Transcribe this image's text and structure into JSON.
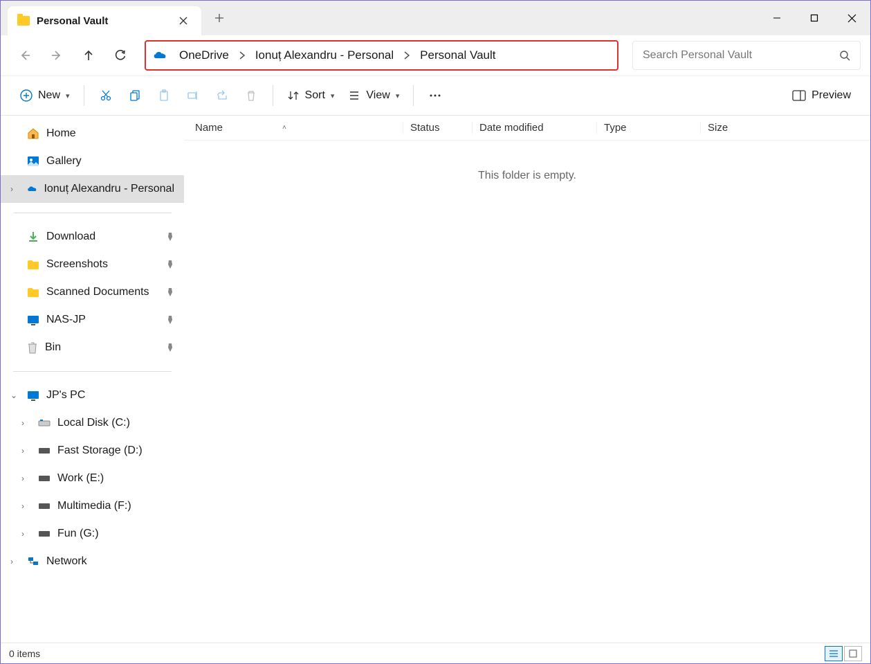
{
  "tab": {
    "title": "Personal Vault"
  },
  "breadcrumb": [
    "OneDrive",
    "Ionuț Alexandru - Personal",
    "Personal Vault"
  ],
  "search": {
    "placeholder": "Search Personal Vault"
  },
  "toolbar": {
    "new": "New",
    "sort": "Sort",
    "view": "View",
    "preview": "Preview"
  },
  "sidebar": {
    "top": [
      {
        "label": "Home",
        "icon": "home"
      },
      {
        "label": "Gallery",
        "icon": "gallery"
      },
      {
        "label": "Ionuț Alexandru - Personal",
        "icon": "cloud",
        "selected": true,
        "expandable": true
      }
    ],
    "quick": [
      {
        "label": "Download",
        "icon": "download"
      },
      {
        "label": "Screenshots",
        "icon": "folder"
      },
      {
        "label": "Scanned Documents",
        "icon": "folder"
      },
      {
        "label": "NAS-JP",
        "icon": "monitor"
      },
      {
        "label": "Bin",
        "icon": "bin"
      }
    ],
    "pc": {
      "label": "JP's PC",
      "expanded": true
    },
    "drives": [
      {
        "label": "Local Disk (C:)"
      },
      {
        "label": "Fast Storage (D:)"
      },
      {
        "label": "Work (E:)"
      },
      {
        "label": "Multimedia (F:)"
      },
      {
        "label": "Fun (G:)"
      }
    ],
    "network": {
      "label": "Network"
    }
  },
  "columns": {
    "name": "Name",
    "status": "Status",
    "date": "Date modified",
    "type": "Type",
    "size": "Size"
  },
  "main": {
    "empty": "This folder is empty."
  },
  "status": {
    "items": "0 items"
  }
}
